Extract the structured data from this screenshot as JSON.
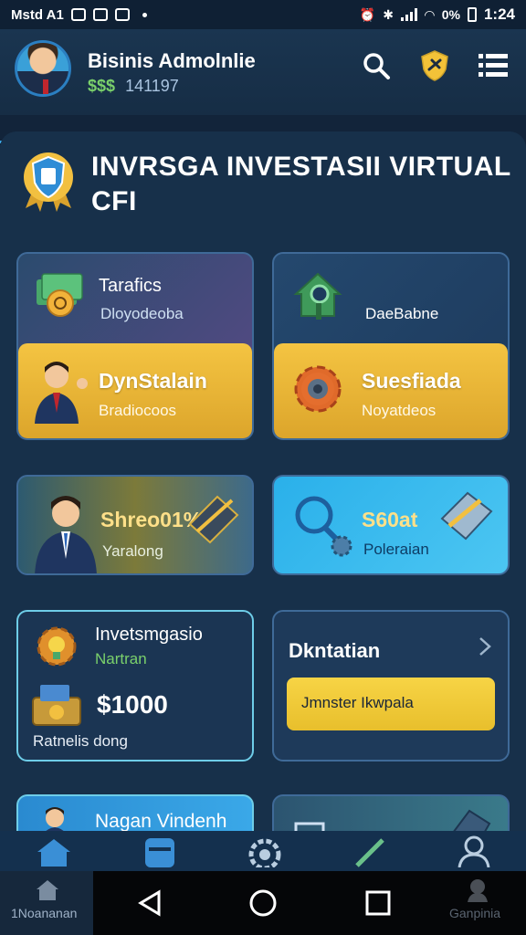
{
  "status_bar": {
    "left_text": "Mstd A1",
    "time": "1:24",
    "battery": "0%"
  },
  "header": {
    "title": "Bisinis Admolnlie",
    "money_symbol": "$$$",
    "balance": "141197",
    "icons": [
      "search-icon",
      "shield-badge-icon",
      "menu-icon"
    ]
  },
  "panel": {
    "title": "INVRSGA INVESTASII VIRTUAL CFI"
  },
  "cards": {
    "c1": {
      "title": "Tarafics",
      "sub": "Dloyodeoba",
      "gold_title": "DynStalain",
      "gold_sub": "Bradiocoos"
    },
    "c2": {
      "title": "",
      "sub": "DaeBabne",
      "gold_title": "Suesfiada",
      "gold_sub": "Noyatdeos"
    },
    "c3": {
      "title": "Shreo01%1",
      "sub": "Yaralong"
    },
    "c4": {
      "title": "S60at",
      "sub": "Poleraian"
    },
    "c5": {
      "title": "Invetsmgasio",
      "sub": "Nartran",
      "amount": "$1000",
      "footer": "Ratnelis dong"
    },
    "c6": {
      "title": "Dkntatian",
      "button": "Jmnster Ikwpala"
    },
    "c7": {
      "title": "Nagan Vindenh"
    }
  },
  "bottom_nav": [
    "home-icon",
    "database-icon",
    "settings-icon",
    "tools-icon",
    "profile-icon"
  ],
  "system_bar": {
    "left_label": "1Noananan",
    "right_label": "Ganpinia"
  },
  "colors": {
    "accent": "#3aa8e8",
    "gold": "#f4c442",
    "green": "#7ad06b"
  }
}
